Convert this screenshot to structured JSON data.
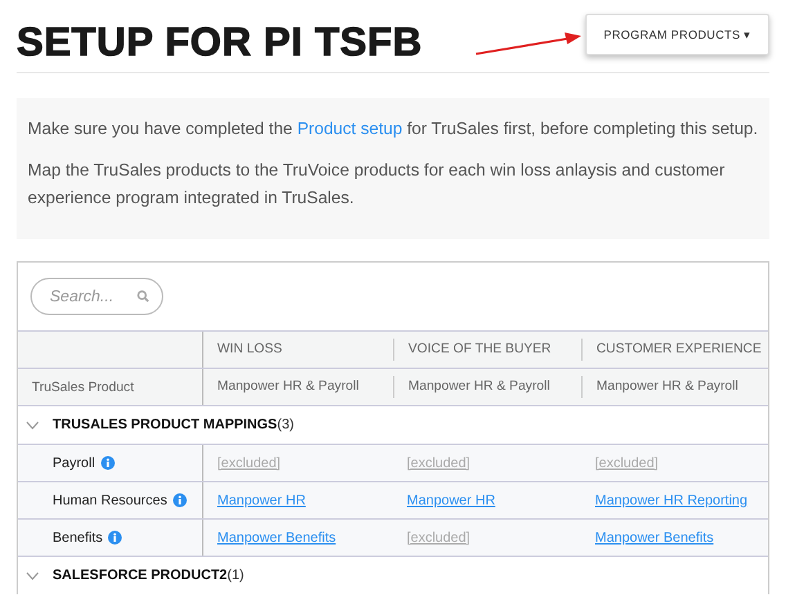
{
  "title": "SETUP FOR PI TSFB",
  "program_button": {
    "label": "PROGRAM PRODUCTS",
    "caret": "▾"
  },
  "info": {
    "paragraphs": [
      {
        "before": "Make sure you have completed the ",
        "link": "Product setup",
        "after": " for TruSales first, before completing this setup."
      },
      {
        "before": "Map the TruSales products to the TruVoice products for each win loss anlaysis and customer experience program integrated in TruSales."
      }
    ]
  },
  "search": {
    "placeholder": "Search..."
  },
  "table": {
    "columns": [
      "WIN LOSS",
      "VOICE OF THE BUYER",
      "CUSTOMER EXPERIENCE"
    ],
    "subheader": {
      "label": "TruSales Product",
      "values": [
        "Manpower HR & Payroll",
        "Manpower HR & Payroll",
        "Manpower HR & Payroll"
      ]
    },
    "groups": [
      {
        "name": "TRUSALES PRODUCT MAPPINGS",
        "count": "(3)",
        "expanded": true,
        "rows": [
          {
            "name": "Payroll",
            "cells": [
              {
                "kind": "excluded",
                "text": "[excluded]"
              },
              {
                "kind": "excluded",
                "text": "[excluded]"
              },
              {
                "kind": "excluded",
                "text": "[excluded]"
              }
            ]
          },
          {
            "name": "Human Resources",
            "cells": [
              {
                "kind": "link",
                "text": "Manpower HR"
              },
              {
                "kind": "link",
                "text": "Manpower HR"
              },
              {
                "kind": "link",
                "text": "Manpower HR Reporting"
              }
            ]
          },
          {
            "name": "Benefits",
            "cells": [
              {
                "kind": "link",
                "text": "Manpower Benefits"
              },
              {
                "kind": "excluded",
                "text": "[excluded]"
              },
              {
                "kind": "link",
                "text": "Manpower Benefits"
              }
            ]
          }
        ]
      },
      {
        "name": "SALESFORCE PRODUCT2",
        "count": "(1)",
        "expanded": true
      }
    ]
  }
}
